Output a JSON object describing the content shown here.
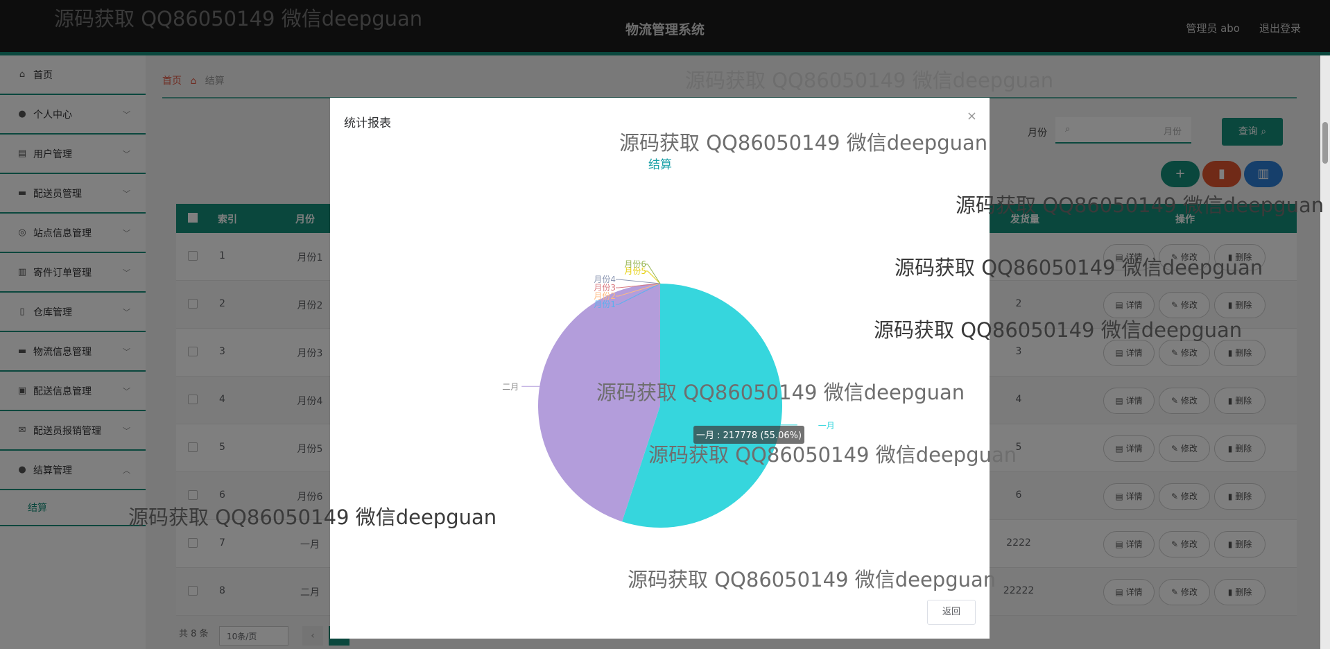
{
  "header": {
    "title": "物流管理系统",
    "user": "管理员 abo",
    "logout": "退出登录"
  },
  "sidebar": {
    "items": [
      {
        "label": "首页",
        "icon": "home-icon"
      },
      {
        "label": "个人中心",
        "icon": "user-icon"
      },
      {
        "label": "用户管理",
        "icon": "clipboard-icon"
      },
      {
        "label": "配送员管理",
        "icon": "monitor-icon"
      },
      {
        "label": "站点信息管理",
        "icon": "compass-icon"
      },
      {
        "label": "寄件订单管理",
        "icon": "chart-icon"
      },
      {
        "label": "仓库管理",
        "icon": "phone-icon"
      },
      {
        "label": "物流信息管理",
        "icon": "monitor-icon"
      },
      {
        "label": "配送信息管理",
        "icon": "briefcase-icon"
      },
      {
        "label": "配送员报销管理",
        "icon": "mail-icon"
      },
      {
        "label": "结算管理",
        "icon": "user-icon"
      }
    ],
    "sub_item": "结算"
  },
  "breadcrumb": {
    "home": "首页",
    "current": "结算"
  },
  "search": {
    "label": "月份",
    "placeholder": "月份",
    "button": "查询"
  },
  "table": {
    "headers": {
      "index": "索引",
      "month": "月份",
      "qty": "发货量",
      "ops": "操作"
    },
    "rows": [
      {
        "idx": "1",
        "month": "月份1",
        "qty": ""
      },
      {
        "idx": "2",
        "month": "月份2",
        "qty": "2"
      },
      {
        "idx": "3",
        "month": "月份3",
        "qty": "3"
      },
      {
        "idx": "4",
        "month": "月份4",
        "qty": "4"
      },
      {
        "idx": "5",
        "month": "月份5",
        "qty": "5"
      },
      {
        "idx": "6",
        "month": "月份6",
        "qty": "6"
      },
      {
        "idx": "7",
        "month": "一月",
        "qty": "2222"
      },
      {
        "idx": "8",
        "month": "二月",
        "qty": "22222"
      }
    ],
    "ops": {
      "detail": "详情",
      "edit": "修改",
      "delete": "删除"
    }
  },
  "pager": {
    "total": "共 8 条",
    "size": "10条/页"
  },
  "dialog": {
    "title": "统计报表",
    "return": "返回"
  },
  "tooltip": "一月 : 217778 (55.06%)",
  "watermark": "源码获取 QQ86050149 微信deepguan",
  "chart_data": {
    "type": "pie",
    "title": "结算",
    "slices": [
      {
        "name": "一月",
        "value": 217778,
        "color": "#36d6dd"
      },
      {
        "name": "二月",
        "value": 177765,
        "color": "#b39ddb"
      },
      {
        "name": "月份1",
        "value": 1,
        "color": "#5ab1ef"
      },
      {
        "name": "月份2",
        "value": 2,
        "color": "#ffb980"
      },
      {
        "name": "月份3",
        "value": 3,
        "color": "#d87a80"
      },
      {
        "name": "月份4",
        "value": 4,
        "color": "#8d98b3"
      },
      {
        "name": "月份5",
        "value": 5,
        "color": "#e5cf0d"
      },
      {
        "name": "月份6",
        "value": 6,
        "color": "#97b552"
      }
    ]
  },
  "colors": {
    "accent": "#148f7a",
    "delete": "#e0542e",
    "chart_btn": "#2d7fd6"
  }
}
